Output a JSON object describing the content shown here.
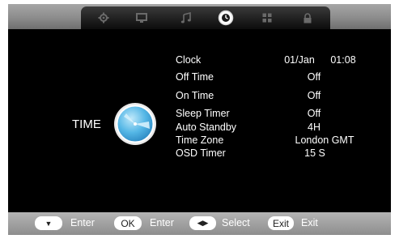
{
  "menu": {
    "title": "TIME",
    "rows": [
      {
        "label": "Clock",
        "value_date": "01/Jan",
        "value_time": "01:08"
      },
      {
        "label": "Off Time",
        "value": "Off"
      },
      {
        "label": "On Time",
        "value": "Off"
      },
      {
        "label": "Sleep Timer",
        "value": "Off"
      },
      {
        "label": "Auto Standby",
        "value": "4H"
      },
      {
        "label": "Time Zone",
        "value": "London GMT"
      },
      {
        "label": "OSD Timer",
        "value": "15 S"
      }
    ]
  },
  "tabs": [
    {
      "icon": "gear-icon"
    },
    {
      "icon": "monitor-icon"
    },
    {
      "icon": "music-note-icon"
    },
    {
      "icon": "clock-icon",
      "selected": true
    },
    {
      "icon": "grid-icon"
    },
    {
      "icon": "lock-icon"
    }
  ],
  "hints": {
    "down_key": "▼",
    "enter1": "Enter",
    "ok_key": "OK",
    "enter2": "Enter",
    "leftright_key": "◀▶",
    "select": "Select",
    "exit_key": "Exit",
    "exit": "Exit"
  },
  "colors": {
    "screen_bg": "#000000",
    "bar_gray": "#9a9a9a",
    "emblem_blue": "#3fa9df"
  }
}
